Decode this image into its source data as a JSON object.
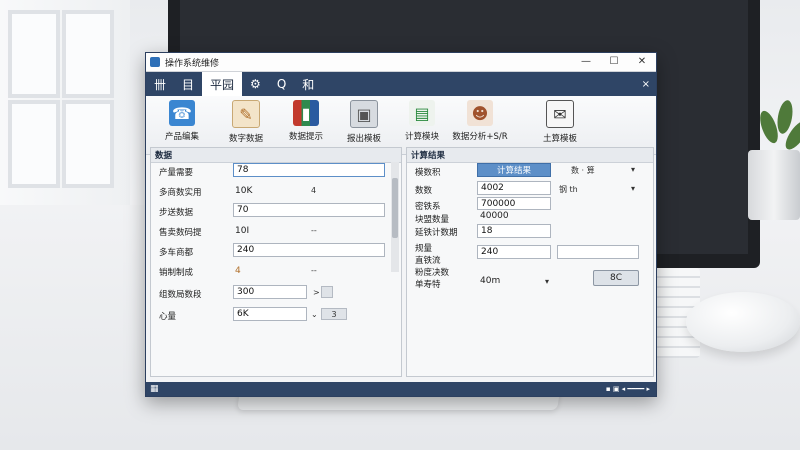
{
  "window": {
    "title": "操作系统维修"
  },
  "menubar": {
    "items": [
      {
        "label": "卌"
      },
      {
        "label": "目"
      },
      {
        "label": "平园"
      },
      {
        "label": "⚙"
      },
      {
        "label": "Q"
      },
      {
        "label": "和"
      }
    ],
    "close": "×"
  },
  "ribbon": {
    "buttons": [
      {
        "label": "产品编集",
        "icon": "phone-icon"
      },
      {
        "label": "数字数据",
        "icon": "document-icon"
      },
      {
        "label": "数据提示",
        "icon": "books-icon"
      },
      {
        "label": "报出模板",
        "icon": "box-icon"
      },
      {
        "label": "计算模块",
        "icon": "chart-icon"
      },
      {
        "label": "数据分析+S/R",
        "icon": "people-icon"
      },
      {
        "label": "土算模板",
        "icon": "envelope-icon"
      }
    ]
  },
  "left_panel": {
    "title": "数据",
    "rows": [
      {
        "label": "产量需要",
        "value": "78"
      },
      {
        "label": "多商数实用",
        "value": "10K",
        "extra": "4"
      },
      {
        "label": "步送数据",
        "value": "70"
      },
      {
        "label": "售卖数码提",
        "value": "10I",
        "extra": "--"
      },
      {
        "label": "多车商都",
        "value": "240"
      },
      {
        "label": "销制制成",
        "value": "4",
        "extra": "--"
      },
      {
        "label": "组数局数段",
        "value": "300",
        "extra": ">"
      },
      {
        "label": "心量",
        "value": "6K",
        "extra": "3"
      }
    ]
  },
  "right_panel": {
    "title": "计算结果",
    "calc_button": "计算结果",
    "dropdown_top": "数 · 算",
    "rows": [
      {
        "label": "模数积",
        "value": ""
      },
      {
        "label": "数数",
        "value": "4002",
        "extra": "钢 th"
      },
      {
        "label": "密铁系",
        "value": "700000"
      },
      {
        "label": "块盟数量",
        "value": "40000"
      },
      {
        "label": "延铁计数期",
        "value": "18"
      },
      {
        "label": "规量",
        "value": ""
      },
      {
        "label": "直铁流",
        "value": "240"
      },
      {
        "label": "粉度决数",
        "value": ""
      },
      {
        "label": "单寿特",
        "value": "40m"
      }
    ],
    "reset_button": "8C"
  },
  "statusbar": {
    "left_icon": "grid-icon"
  }
}
